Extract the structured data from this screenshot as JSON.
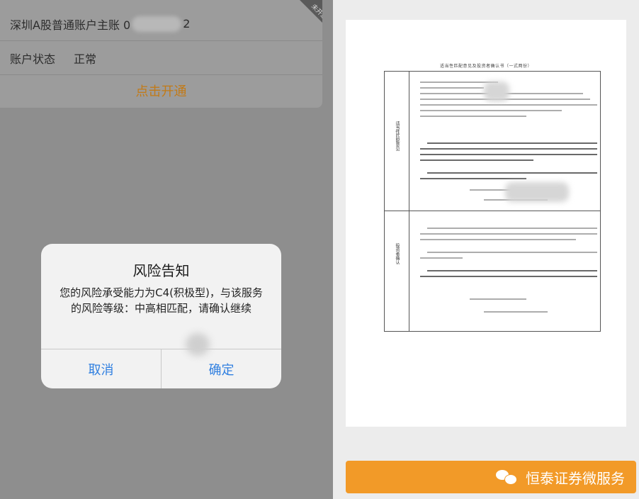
{
  "account_card": {
    "account_prefix": "深圳A股普通账户主账 0",
    "account_suffix": "2",
    "corner_badge": "未开通",
    "status_label": "账户状态",
    "status_value": "正常",
    "open_action": "点击开通"
  },
  "dialog": {
    "title": "风险告知",
    "message": "您的风险承受能力为C4(积极型)，与该服务的风险等级：中高相匹配，请确认继续",
    "cancel_label": "取消",
    "confirm_label": "确定"
  },
  "document": {
    "title": "适当性匹配意见及投资者确认书（一式两份）",
    "section1_label": "适当性匹配意见",
    "section2_label": "投资者确认"
  },
  "footer_bar": {
    "label": "恒泰证券微服务",
    "icon": "wechat-icon"
  }
}
